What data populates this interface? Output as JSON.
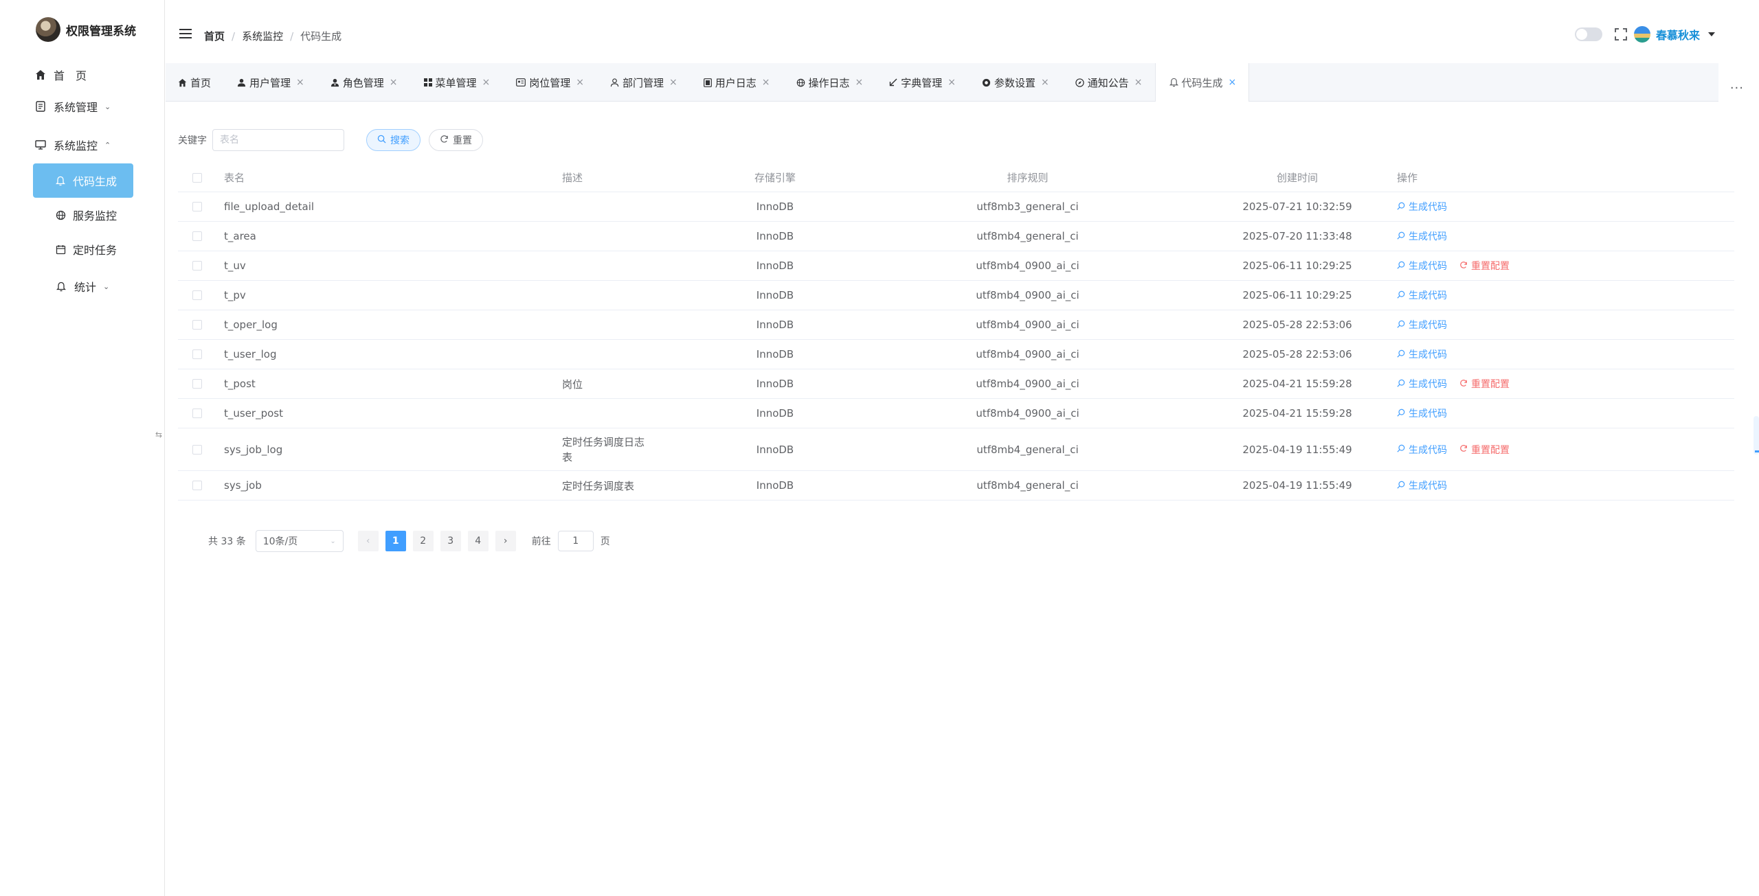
{
  "sidebar": {
    "title": "权限管理系统",
    "items": [
      {
        "label": "首　页"
      },
      {
        "label": "系统管理"
      },
      {
        "label": "系统监控"
      },
      {
        "label": "代码生成"
      },
      {
        "label": "服务监控"
      },
      {
        "label": "定时任务"
      },
      {
        "label": "统计"
      }
    ],
    "active_color": "#6cbdf0"
  },
  "header": {
    "breadcrumb": [
      "首页",
      "系统监控",
      "代码生成"
    ],
    "user_name": "春慕秋来"
  },
  "tabs": [
    {
      "label": "首页",
      "icon": "home-icon"
    },
    {
      "label": "用户管理",
      "icon": "user-icon"
    },
    {
      "label": "角色管理",
      "icon": "user-tie-icon"
    },
    {
      "label": "菜单管理",
      "icon": "grid-icon"
    },
    {
      "label": "岗位管理",
      "icon": "id-card-icon"
    },
    {
      "label": "部门管理",
      "icon": "user-outline-icon"
    },
    {
      "label": "用户日志",
      "icon": "log-icon"
    },
    {
      "label": "操作日志",
      "icon": "globe-icon"
    },
    {
      "label": "字典管理",
      "icon": "arrow-icon"
    },
    {
      "label": "参数设置",
      "icon": "chrome-icon"
    },
    {
      "label": "通知公告",
      "icon": "compass-icon"
    },
    {
      "label": "代码生成",
      "icon": "bell-icon"
    }
  ],
  "search": {
    "label": "关键字",
    "placeholder": "表名",
    "search_button": "搜索",
    "reset_button": "重置"
  },
  "table": {
    "headers": [
      "表名",
      "描述",
      "存储引擎",
      "排序规则",
      "创建时间",
      "操作"
    ],
    "gen_label": "生成代码",
    "reset_label": "重置配置",
    "rows": [
      {
        "name": "file_upload_detail",
        "desc": "",
        "engine": "InnoDB",
        "collation": "utf8mb3_general_ci",
        "created": "2025-07-21 10:32:59"
      },
      {
        "name": "t_area",
        "desc": "",
        "engine": "InnoDB",
        "collation": "utf8mb4_general_ci",
        "created": "2025-07-20 11:33:48"
      },
      {
        "name": "t_uv",
        "desc": "",
        "engine": "InnoDB",
        "collation": "utf8mb4_0900_ai_ci",
        "created": "2025-06-11 10:29:25"
      },
      {
        "name": "t_pv",
        "desc": "",
        "engine": "InnoDB",
        "collation": "utf8mb4_0900_ai_ci",
        "created": "2025-06-11 10:29:25"
      },
      {
        "name": "t_oper_log",
        "desc": "",
        "engine": "InnoDB",
        "collation": "utf8mb4_0900_ai_ci",
        "created": "2025-05-28 22:53:06"
      },
      {
        "name": "t_user_log",
        "desc": "",
        "engine": "InnoDB",
        "collation": "utf8mb4_0900_ai_ci",
        "created": "2025-05-28 22:53:06"
      },
      {
        "name": "t_post",
        "desc": "岗位",
        "engine": "InnoDB",
        "collation": "utf8mb4_0900_ai_ci",
        "created": "2025-04-21 15:59:28"
      },
      {
        "name": "t_user_post",
        "desc": "",
        "engine": "InnoDB",
        "collation": "utf8mb4_0900_ai_ci",
        "created": "2025-04-21 15:59:28"
      },
      {
        "name": "sys_job_log",
        "desc": "定时任务调度日志表",
        "engine": "InnoDB",
        "collation": "utf8mb4_general_ci",
        "created": "2025-04-19 11:55:49"
      },
      {
        "name": "sys_job",
        "desc": "定时任务调度表",
        "engine": "InnoDB",
        "collation": "utf8mb4_general_ci",
        "created": "2025-04-19 11:55:49"
      }
    ]
  },
  "pagination": {
    "total": "共 33 条",
    "page_size": "10条/页",
    "pages": [
      "1",
      "2",
      "3",
      "4"
    ],
    "current": "1",
    "goto_label": "前往",
    "goto_value": "1",
    "page_suffix": "页",
    "prev": "‹",
    "next": "›"
  },
  "colors": {
    "primary": "#409eff",
    "danger": "#f56c6c",
    "sidebar_active": "#6cbdf0",
    "user_name": "#1890d8"
  }
}
